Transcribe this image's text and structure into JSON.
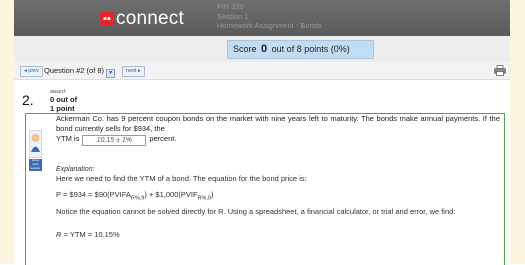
{
  "header": {
    "logo_mark": "▪▪",
    "logo_text": "connect",
    "course_code": "FIN 320",
    "section": "Section 1",
    "assignment": "Homework Assignment - Bonds"
  },
  "score": {
    "label": "Score",
    "value": "0",
    "suffix": "out of 8 points (0%)"
  },
  "nav": {
    "prev_label": "◂ prev",
    "next_label": "next ▸",
    "question_selector": "Question #2 (of 8)"
  },
  "question": {
    "number": "2.",
    "award_label": "award:",
    "points_line1": "0 out of",
    "points_line2": "1 point",
    "text": "Ackerman Co. has 9 percent coupon bonds on the market with nine years left to maturity. The bonds make annual payments. If the bond currently sells for $934, the",
    "answer_prefix": "YTM is",
    "answer_value": "10.15 ± 1%",
    "answer_suffix": "percent.",
    "side_tag": "show work answer"
  },
  "explanation": {
    "label": "Explanation:",
    "intro": "Here we need to find the YTM of a bond. The equation for the bond price is:",
    "equation_part1": "P = $934 = $90(PVIFA",
    "equation_sub1": "R%,9",
    "equation_part2": ") + $1,000(PVIF",
    "equation_sub2": "R%,9",
    "equation_part3": ")",
    "note": "Notice the equation cannot be solved directly for R. Using a spreadsheet, a financial calculator, or trial and error, we find:",
    "result_var": "R",
    "result_text": " = YTM = 10.15%"
  },
  "colors": {
    "header_bg": "#5f5f5f",
    "brand_red": "#e4232b",
    "score_pill": "#c2dcf1",
    "question_border": "#52a052",
    "page_bg": "#fcf6df"
  }
}
